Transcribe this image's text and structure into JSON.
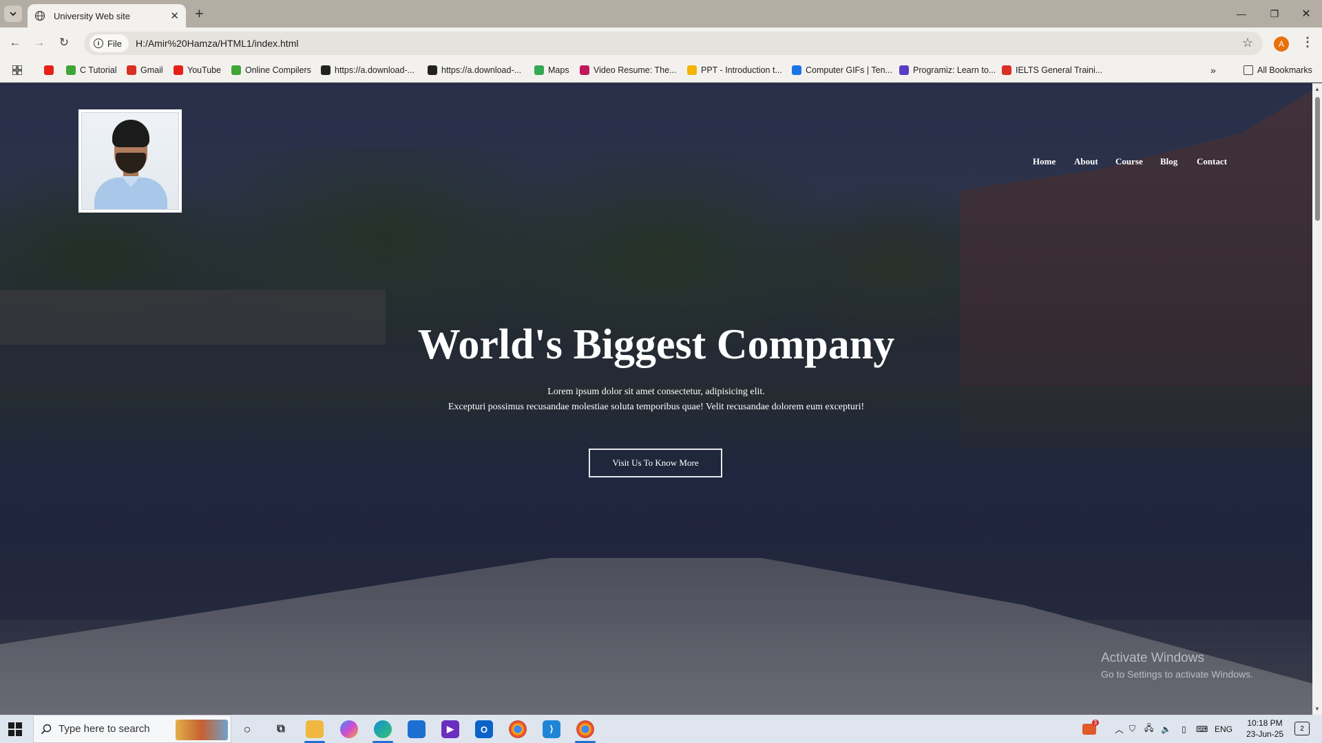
{
  "browser": {
    "tab_title": "University Web site",
    "address_chip": "File",
    "url": "H:/Amir%20Hamza/HTML1/index.html",
    "profile_initial": "A",
    "bookmarks": [
      {
        "label": "",
        "icon": "youtube-icon",
        "color": "#e62117"
      },
      {
        "label": "C Tutorial",
        "icon": "compiler-icon",
        "color": "#3fa535"
      },
      {
        "label": "Gmail",
        "icon": "gmail-icon",
        "color": "#d93025"
      },
      {
        "label": "YouTube",
        "icon": "youtube-icon",
        "color": "#e62117"
      },
      {
        "label": "Online Compilers",
        "icon": "compiler-icon",
        "color": "#3fa535"
      },
      {
        "label": "https://a.download-...",
        "icon": "download-icon",
        "color": "#222222"
      },
      {
        "label": "https://a.download-...",
        "icon": "download-icon",
        "color": "#222222"
      },
      {
        "label": "Maps",
        "icon": "maps-icon",
        "color": "#34a853"
      },
      {
        "label": "Video Resume: The...",
        "icon": "video-resume-icon",
        "color": "#c2185b"
      },
      {
        "label": "PPT - Introduction t...",
        "icon": "ppt-icon",
        "color": "#f4b400"
      },
      {
        "label": "Computer GIFs | Ten...",
        "icon": "gif-icon",
        "color": "#1a73e8"
      },
      {
        "label": "Programiz: Learn to...",
        "icon": "programiz-icon",
        "color": "#5b3cc4"
      },
      {
        "label": "IELTS General Traini...",
        "icon": "ielts-icon",
        "color": "#d93025"
      }
    ],
    "all_bookmarks": "All Bookmarks"
  },
  "site": {
    "nav": [
      "Home",
      "About",
      "Course",
      "Blog",
      "Contact"
    ],
    "hero": {
      "title": "World's Biggest Company",
      "line1": "Lorem ipsum dolor sit amet consectetur, adipisicing elit.",
      "line2": "Excepturi possimus recusandae molestiae soluta temporibus quae! Velit recusandae dolorem eum excepturi!",
      "button": "Visit Us To Know More"
    }
  },
  "watermark": {
    "title": "Activate Windows",
    "subtitle": "Go to Settings to activate Windows."
  },
  "taskbar": {
    "search_placeholder": "Type here to search",
    "language": "ENG",
    "time": "10:18 PM",
    "date": "23-Jun-25",
    "notification_badge": "3",
    "action_center_count": "2"
  }
}
